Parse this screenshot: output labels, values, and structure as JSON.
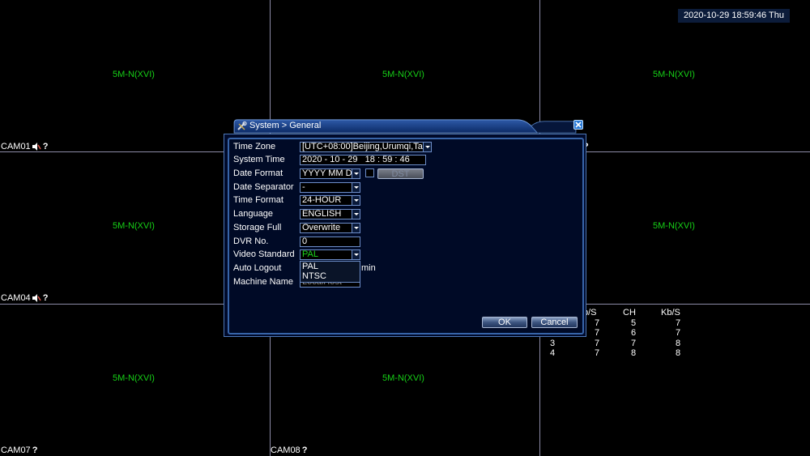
{
  "clock": "2020-10-29 18:59:46 Thu",
  "cells": [
    {
      "mode": "5M-N(XVI)",
      "cam": "",
      "speaker": false
    },
    {
      "mode": "5M-N(XVI)",
      "cam": "",
      "speaker": false
    },
    {
      "mode": "5M-N(XVI)",
      "cam": "",
      "speaker": false
    },
    {
      "mode": "5M-N(XVI)",
      "cam": "CAM01",
      "speaker": true
    },
    {
      "mode": "",
      "cam": "",
      "speaker": false
    },
    {
      "mode": "5M-N(XVI)",
      "cam": "",
      "speaker": false
    },
    {
      "mode": "5M-N(XVI)",
      "cam": "CAM04",
      "speaker": true
    },
    {
      "mode": "5M-N(XVI)",
      "cam": "CAM07",
      "speaker": false
    },
    {
      "mode": "5M-N(XVI)",
      "cam": "CAM08",
      "speaker": false
    }
  ],
  "stats": {
    "headers": [
      "b/S",
      "CH",
      "Kb/S"
    ],
    "rows": [
      [
        "7",
        "5",
        "7"
      ],
      [
        "7",
        "6",
        "7"
      ],
      [
        "3",
        "7",
        "7",
        "8"
      ],
      [
        "4",
        "7",
        "8",
        "8"
      ]
    ]
  },
  "dialog": {
    "title": "System > General",
    "labels": {
      "time_zone": "Time Zone",
      "system_time": "System Time",
      "date_format": "Date Format",
      "date_separator": "Date Separator",
      "time_format": "Time Format",
      "language": "Language",
      "storage_full": "Storage Full",
      "dvr_no": "DVR No.",
      "video_standard": "Video Standard",
      "auto_logout": "Auto Logout",
      "machine_name": "Machine Name"
    },
    "values": {
      "time_zone": "[UTC+08:00]Beijing,Urumqi,Ta",
      "system_date": "2020 - 10 - 29",
      "system_time": "18 :  59 : 46",
      "date_format": "YYYY MM D",
      "date_separator": "-",
      "time_format": "24-HOUR",
      "language": "ENGLISH",
      "storage_full": "Overwrite",
      "dvr_no": "0",
      "video_standard": "PAL",
      "auto_logout_unit": "min",
      "machine_name": "LocalHost"
    },
    "dst_button": "DST",
    "video_standard_options": [
      "PAL",
      "NTSC"
    ],
    "ok_label": "OK",
    "cancel_label": "Cancel",
    "colors": {
      "accent": "#4d78b8",
      "video_standard_text": "#1bd61b"
    }
  }
}
